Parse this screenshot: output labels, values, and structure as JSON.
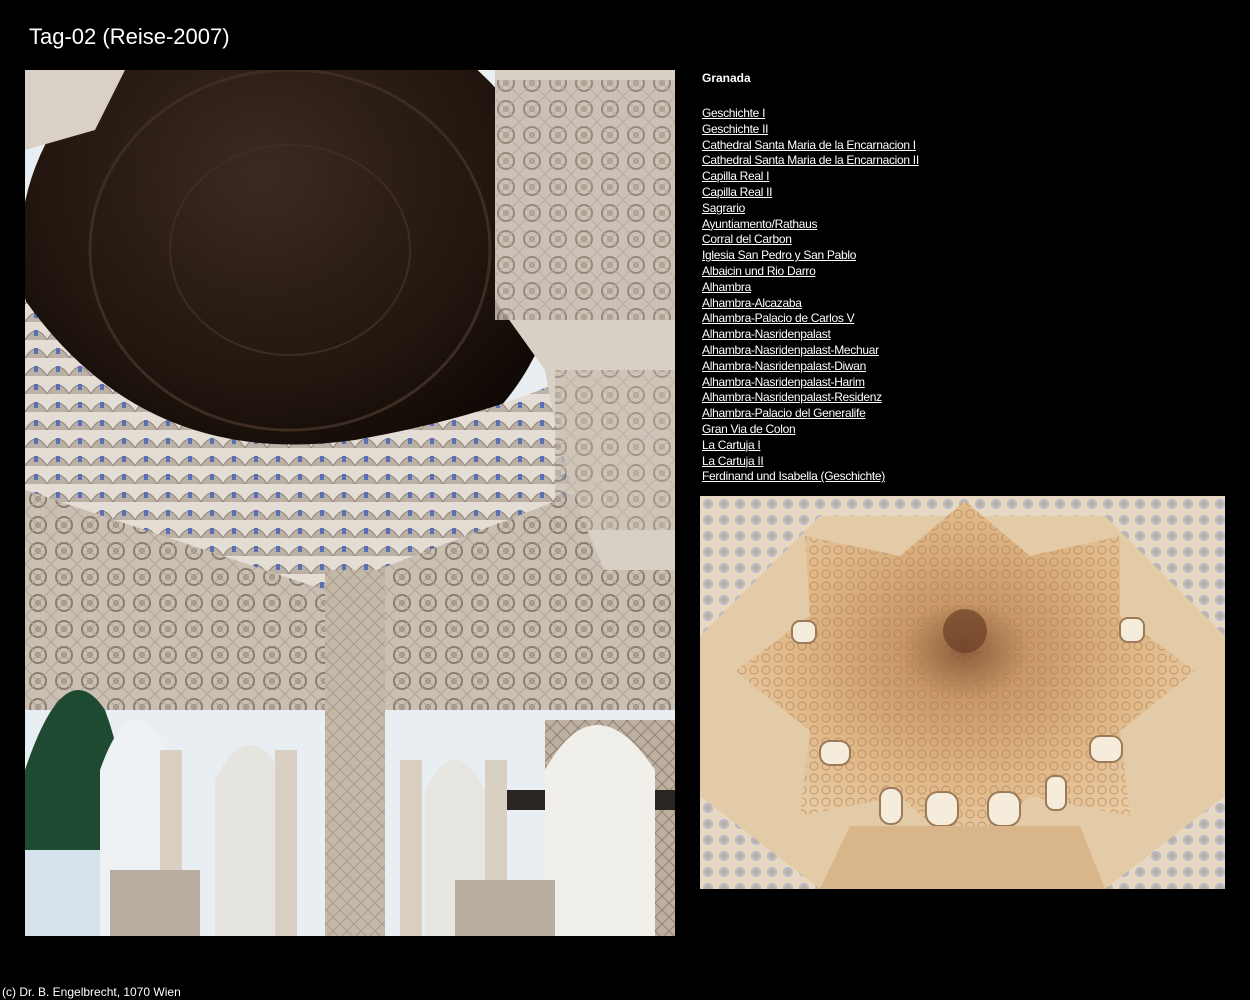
{
  "page": {
    "title": "Tag-02 (Reise-2007)"
  },
  "sidebar": {
    "heading": "Granada",
    "links": [
      {
        "label": "Geschichte I"
      },
      {
        "label": "Geschichte II"
      },
      {
        "label": "Cathedral Santa Maria de la Encarnacion I"
      },
      {
        "label": "Cathedral Santa Maria de la Encarnacion II"
      },
      {
        "label": "Capilla Real I"
      },
      {
        "label": "Capilla Real II"
      },
      {
        "label": "Sagrario"
      },
      {
        "label": "Ayuntiamento/Rathaus"
      },
      {
        "label": "Corral del Carbon"
      },
      {
        "label": "Iglesia San Pedro y San Pablo"
      },
      {
        "label": "Albaicin und Rio Darro"
      },
      {
        "label": "Alhambra"
      },
      {
        "label": "Alhambra-Alcazaba"
      },
      {
        "label": "Alhambra-Palacio de Carlos V"
      },
      {
        "label": "Alhambra-Nasridenpalast"
      },
      {
        "label": "Alhambra-Nasridenpalast-Mechuar"
      },
      {
        "label": "Alhambra-Nasridenpalast-Diwan"
      },
      {
        "label": "Alhambra-Nasridenpalast-Harim"
      },
      {
        "label": "Alhambra-Nasridenpalast-Residenz"
      },
      {
        "label": "Alhambra-Palacio del Generalife"
      },
      {
        "label": "Gran Via de Colon"
      },
      {
        "label": "La Cartuja I"
      },
      {
        "label": "La Cartuja II"
      },
      {
        "label": "Ferdinand und Isabella (Geschichte)"
      }
    ]
  },
  "footer": {
    "text": "(c) Dr. B. Engelbrecht, 1070 Wien"
  },
  "colors": {
    "background": "#000000",
    "text": "#ffffff"
  }
}
